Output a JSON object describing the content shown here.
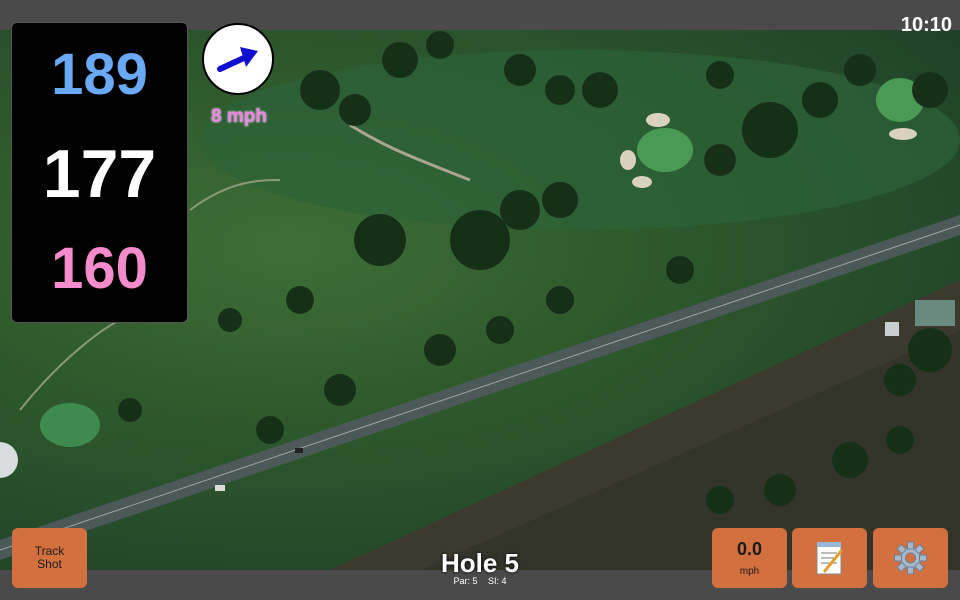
{
  "status_bar": {
    "time": "10:10"
  },
  "distances": {
    "back": "189",
    "middle": "177",
    "front": "160"
  },
  "wind": {
    "speed": "8 mph",
    "icon": "wind-arrow-icon"
  },
  "buttons": {
    "track_shot_line1": "Track",
    "track_shot_line2": "Shot",
    "speed_value": "0.0",
    "speed_unit": "mph",
    "notes_icon": "notepad-icon",
    "settings_icon": "gear-icon"
  },
  "hole": {
    "title": "Hole 5",
    "par": "Par: 5",
    "si": "SI: 4"
  },
  "colors": {
    "back": "#69a9f5",
    "middle": "#ffffff",
    "front": "#f48bcc",
    "wind_text": "#f07fe6",
    "button": "#d2703f"
  }
}
